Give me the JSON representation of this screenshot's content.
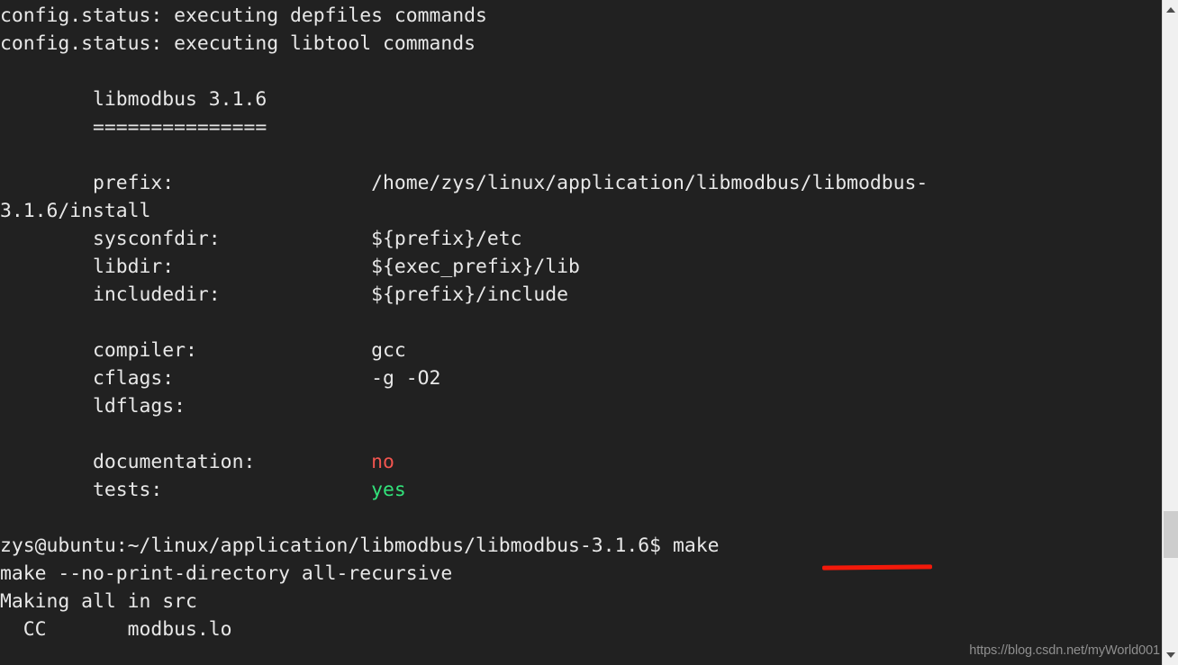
{
  "terminal": {
    "background_color": "#212121",
    "foreground_color": "#e8e8e8",
    "lines": {
      "l01": "config.status: executing depfiles commands",
      "l02": "config.status: executing libtool commands",
      "l03": "",
      "l04": "        libmodbus 3.1.6",
      "l05": "        ===============",
      "l06": "",
      "l07": "        prefix:                 /home/zys/linux/application/libmodbus/libmodbus-",
      "l08": "3.1.6/install",
      "l09": "        sysconfdir:             ${prefix}/etc",
      "l10": "        libdir:                 ${exec_prefix}/lib",
      "l11": "        includedir:             ${prefix}/include",
      "l12": "",
      "l13": "        compiler:               gcc",
      "l14": "        cflags:                 -g -O2",
      "l15": "        ldflags:",
      "l16": "",
      "l17_label": "        documentation:          ",
      "l17_value": "no",
      "l18_label": "        tests:                  ",
      "l18_value": "yes",
      "l19": "",
      "l20": "zys@ubuntu:~/linux/application/libmodbus/libmodbus-3.1.6$ make",
      "l21": "make --no-print-directory all-recursive",
      "l22": "Making all in src",
      "l23": "  CC       modbus.lo"
    },
    "value_colors": {
      "documentation": "#f1554f",
      "tests": "#32e27a"
    }
  },
  "annotation": {
    "underline_color": "#f3190a",
    "underlines_text": "make"
  },
  "scrollbar": {
    "up_arrow": "chevron-up-icon",
    "down_arrow": "chevron-down-icon",
    "track_color": "#f0f0f0",
    "thumb_color": "#cdcdcd"
  },
  "watermark": {
    "text": "https://blog.csdn.net/myWorld001"
  }
}
